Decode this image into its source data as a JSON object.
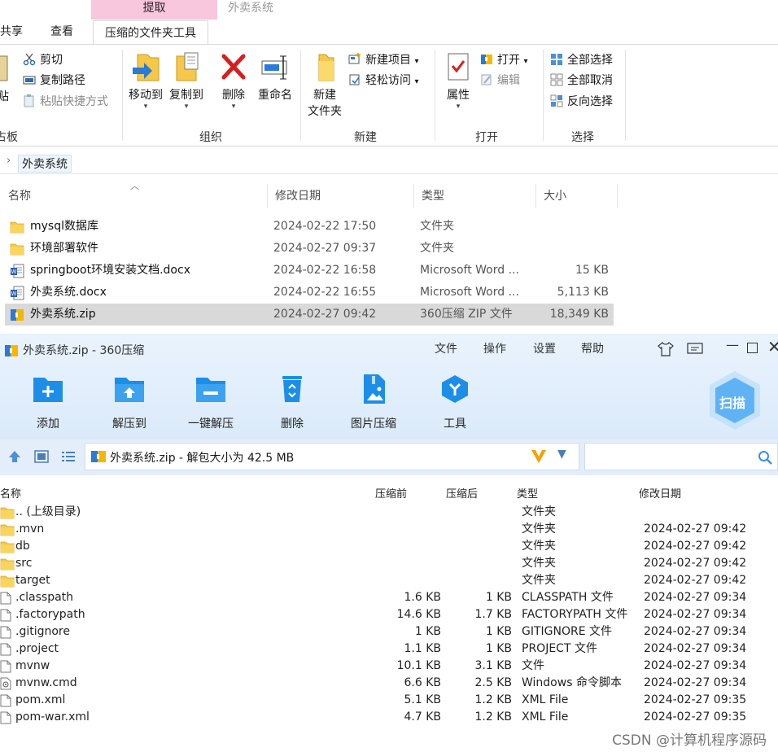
{
  "explorer": {
    "context_tab": "提取",
    "window_title": "外卖系统",
    "ribbon_tabs": [
      "共享",
      "查看",
      "压缩的文件夹工具"
    ],
    "clipboard": {
      "cut": "剪切",
      "copy_path": "复制路径",
      "paste_shortcut": "粘贴快捷方式",
      "paste_partial": "贴",
      "group_partial": "占板"
    },
    "organize": {
      "move_to": "移动到",
      "copy_to": "复制到",
      "delete": "删除",
      "rename": "重命名",
      "group": "组织"
    },
    "new_group": {
      "new_folder_line1": "新建",
      "new_folder_line2": "文件夹",
      "new_item": "新建项目",
      "easy_access": "轻松访问",
      "group": "新建"
    },
    "open_group": {
      "properties": "属性",
      "open": "打开",
      "edit": "编辑",
      "group": "打开"
    },
    "select_group": {
      "select_all": "全部选择",
      "select_none": "全部取消",
      "invert": "反向选择",
      "group": "选择"
    },
    "address": "外卖系统",
    "columns": {
      "name": "名称",
      "modified": "修改日期",
      "type": "类型",
      "size": "大小"
    },
    "files": [
      {
        "name": "mysql数据库",
        "modified": "2024-02-22 17:50",
        "type": "文件夹",
        "size": "",
        "icon": "folder-icon"
      },
      {
        "name": "环境部署软件",
        "modified": "2024-02-27 09:37",
        "type": "文件夹",
        "size": "",
        "icon": "folder-icon"
      },
      {
        "name": "springboot环境安装文档.docx",
        "modified": "2024-02-22 16:58",
        "type": "Microsoft Word ...",
        "size": "15 KB",
        "icon": "word-doc-icon"
      },
      {
        "name": "外卖系统.docx",
        "modified": "2024-02-22 16:55",
        "type": "Microsoft Word ...",
        "size": "5,113 KB",
        "icon": "word-doc-icon"
      },
      {
        "name": "外卖系统.zip",
        "modified": "2024-02-27 09:42",
        "type": "360压缩 ZIP 文件",
        "size": "18,349 KB",
        "icon": "zip-archive-icon"
      }
    ]
  },
  "zip": {
    "title": "外卖系统.zip - 360压缩",
    "menu": [
      "文件",
      "操作",
      "设置",
      "帮助"
    ],
    "tools": [
      "添加",
      "解压到",
      "一键解压",
      "删除",
      "图片压缩",
      "工具"
    ],
    "scan": "扫描",
    "path": "外卖系统.zip - 解包大小为 42.5 MB",
    "columns": {
      "name": "名称",
      "packed": "压缩前",
      "compressed": "压缩后",
      "type": "类型",
      "modified": "修改日期"
    },
    "files": [
      {
        "name": ".. (上级目录)",
        "before": "",
        "after": "",
        "type": "文件夹",
        "modified": "",
        "icon": "folder-icon"
      },
      {
        "name": ".mvn",
        "before": "",
        "after": "",
        "type": "文件夹",
        "modified": "2024-02-27 09:42",
        "icon": "folder-icon"
      },
      {
        "name": "db",
        "before": "",
        "after": "",
        "type": "文件夹",
        "modified": "2024-02-27 09:42",
        "icon": "folder-icon"
      },
      {
        "name": "src",
        "before": "",
        "after": "",
        "type": "文件夹",
        "modified": "2024-02-27 09:42",
        "icon": "folder-icon"
      },
      {
        "name": "target",
        "before": "",
        "after": "",
        "type": "文件夹",
        "modified": "2024-02-27 09:42",
        "icon": "folder-icon"
      },
      {
        "name": ".classpath",
        "before": "1.6 KB",
        "after": "1 KB",
        "type": "CLASSPATH 文件",
        "modified": "2024-02-27 09:34",
        "icon": "file-icon"
      },
      {
        "name": ".factorypath",
        "before": "14.6 KB",
        "after": "1.7 KB",
        "type": "FACTORYPATH 文件",
        "modified": "2024-02-27 09:34",
        "icon": "file-icon"
      },
      {
        "name": ".gitignore",
        "before": "1 KB",
        "after": "1 KB",
        "type": "GITIGNORE 文件",
        "modified": "2024-02-27 09:34",
        "icon": "file-icon"
      },
      {
        "name": ".project",
        "before": "1.1 KB",
        "after": "1 KB",
        "type": "PROJECT 文件",
        "modified": "2024-02-27 09:34",
        "icon": "file-icon"
      },
      {
        "name": "mvnw",
        "before": "10.1 KB",
        "after": "3.1 KB",
        "type": "文件",
        "modified": "2024-02-27 09:34",
        "icon": "file-icon"
      },
      {
        "name": "mvnw.cmd",
        "before": "6.6 KB",
        "after": "2.5 KB",
        "type": "Windows 命令脚本",
        "modified": "2024-02-27 09:34",
        "icon": "script-file-icon"
      },
      {
        "name": "pom.xml",
        "before": "5.1 KB",
        "after": "1.2 KB",
        "type": "XML File",
        "modified": "2024-02-27 09:35",
        "icon": "file-icon"
      },
      {
        "name": "pom-war.xml",
        "before": "4.7 KB",
        "after": "1.2 KB",
        "type": "XML File",
        "modified": "2024-02-27 09:35",
        "icon": "file-icon"
      }
    ]
  },
  "watermark": "CSDN @计算机程序源码"
}
